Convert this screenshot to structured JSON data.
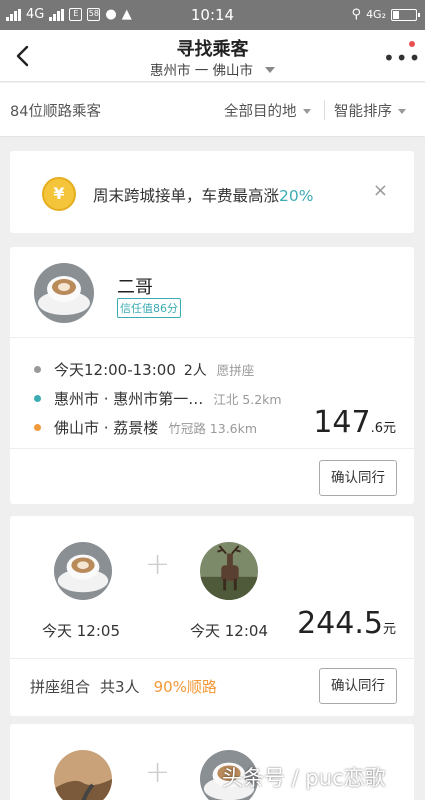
{
  "status_bar": {
    "network1": "4G",
    "network2": "4G",
    "notif_box1": "E",
    "notif_box2": "58",
    "time": "10:14",
    "right_network": "4G₂"
  },
  "nav": {
    "title": "寻找乘客",
    "subtitle": "惠州市 一 佛山市"
  },
  "filter": {
    "count": "84位顺路乘客",
    "destination": "全部目的地",
    "sort": "智能排序"
  },
  "promo": {
    "coin_symbol": "¥",
    "text_prefix": "周末跨城接单，车费最高涨",
    "text_highlight": "20%",
    "close": "×"
  },
  "cards": [
    {
      "name": "二哥",
      "trust": "信任值86分",
      "time": "今天12:00-13:00",
      "seats": "2人",
      "seat_note": "愿拼座",
      "from": "惠州市 · 惠州市第一…",
      "from_detail": "江北 5.2km",
      "to": "佛山市 · 荔景楼",
      "to_detail": "竹冠路 13.6km",
      "price_int": "147",
      "price_dec": ".6元",
      "button": "确认同行"
    },
    {
      "time1": "今天 12:05",
      "time2": "今天 12:04",
      "price_int": "244.5",
      "price_dec": "元",
      "foot_label": "拼座组合",
      "foot_total": "共3人",
      "foot_percent": "90%顺路",
      "button": "确认同行"
    }
  ],
  "watermark": "头条号 / puc恋歌",
  "colors": {
    "accent": "#3cacb4",
    "orange": "#f29a3b",
    "dot_start": "#999999",
    "dot_from": "#3cacb4",
    "dot_to": "#f29a3b"
  },
  "icons": [
    "back-icon",
    "more-icon",
    "caret-down-icon",
    "coin-icon",
    "close-icon",
    "plus-icon"
  ]
}
